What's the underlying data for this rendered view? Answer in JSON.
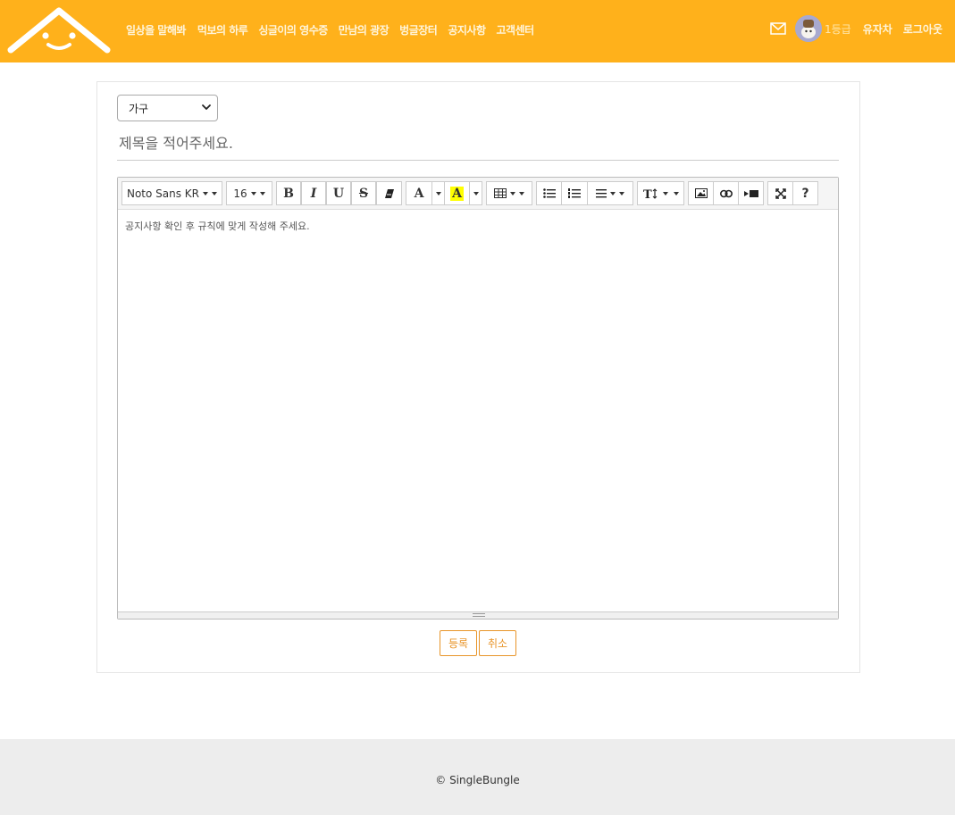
{
  "header": {
    "nav": [
      "일상을 말해봐",
      "먹보의 하루",
      "싱글이의 영수증",
      "만남의 광장",
      "벙글장터",
      "공지사항",
      "고객센터"
    ],
    "grade": "1등급",
    "username": "유자차",
    "logout": "로그아웃",
    "brand_color": "#ffb11b"
  },
  "form": {
    "category": "가구",
    "title_placeholder": "제목을 적어주세요.",
    "body_placeholder": "공지사항 확인 후 규칙에 맞게 작성해 주세요."
  },
  "toolbar": {
    "font_name": "Noto Sans KR",
    "font_size": "16",
    "bold": "B",
    "italic": "I",
    "underline": "U",
    "strike": "S",
    "fore_color": "A",
    "back_color": "A",
    "help": "?",
    "icons": [
      "eraser-icon",
      "table-icon",
      "bullet-list-icon",
      "ordered-list-icon",
      "align-icon",
      "line-height-icon",
      "picture-icon",
      "link-icon",
      "video-icon",
      "fullscreen-icon"
    ]
  },
  "buttons": {
    "submit": "등록",
    "cancel": "취소",
    "accent": "#e8952a"
  },
  "footer": {
    "copyright": "© SingleBungle"
  }
}
